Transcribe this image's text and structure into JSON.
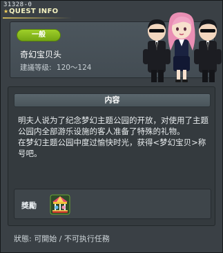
{
  "window": {
    "id_text": "31328-0",
    "title": "QUEST INFO"
  },
  "quest": {
    "category": "一般",
    "name": "奇幻宝贝头",
    "level_label": "建議等级:",
    "level_range": "120～124"
  },
  "content": {
    "header": "内容",
    "body": "明夫人说为了纪念梦幻主题公园的开放，对使用了主题公园内全部游乐设施的客人准备了特殊的礼物。\n在梦幻主题公园中度过愉快时光，获得<梦幻宝贝>称号吧。"
  },
  "reward": {
    "label": "獎勵",
    "item_icon": "carousel-badge-icon"
  },
  "status": {
    "text": "狀態: 可開始 / 不可执行任務"
  },
  "colors": {
    "category_green": "#8bbf1f",
    "title_yellow": "#f4f2c0"
  }
}
